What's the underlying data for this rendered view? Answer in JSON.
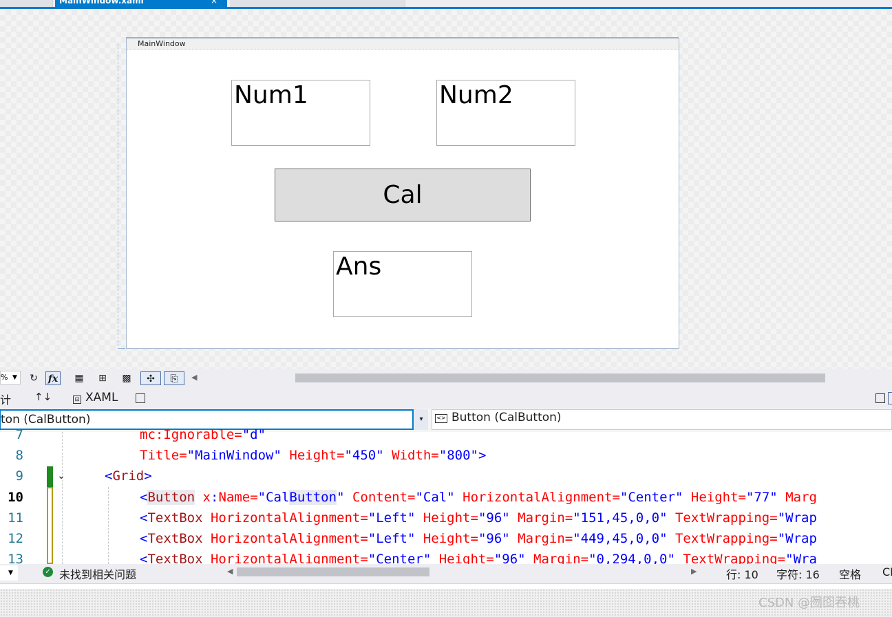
{
  "doc_tab": {
    "title": "MainWindow.xaml",
    "close_glyph": "×"
  },
  "designer": {
    "window_title": "MainWindow",
    "num1": "Num1",
    "num2": "Num2",
    "cal_button": "Cal",
    "ans": "Ans"
  },
  "toolbar": {
    "zoom_value": "%",
    "refresh_icon": "refresh-icon",
    "fx_label": "fx"
  },
  "view_tabs": {
    "design_label": "计",
    "swap_glyph": "↑↓",
    "xaml_label": "XAML"
  },
  "nav": {
    "left_value": "ton (CalButton)",
    "right_value": "Button (CalButton)",
    "dropdown_glyph": "▾"
  },
  "code": {
    "lines": [
      {
        "num": "7",
        "text": "mc:Ignorable=\"d\""
      },
      {
        "num": "8",
        "text": "Title=\"MainWindow\" Height=\"450\" Width=\"800\">"
      },
      {
        "num": "9",
        "text": "<Grid>"
      },
      {
        "num": "10",
        "text": "<Button x:Name=\"CalButton\" Content=\"Cal\" HorizontalAlignment=\"Center\" Height=\"77\" Marg"
      },
      {
        "num": "11",
        "text": "<TextBox HorizontalAlignment=\"Left\" Height=\"96\" Margin=\"151,45,0,0\" TextWrapping=\"Wrap"
      },
      {
        "num": "12",
        "text": "<TextBox HorizontalAlignment=\"Left\" Height=\"96\" Margin=\"449,45,0,0\" TextWrapping=\"Wrap"
      },
      {
        "num": "13",
        "text": "<TextBox HorizontalAlignment=\"Center\" Height=\"96\" Margin=\"0,294,0,0\" TextWrapping=\"Wra"
      }
    ]
  },
  "status": {
    "message": "未找到相关问题",
    "line": "行: 10",
    "char": "字符: 16",
    "spaces": "空格",
    "eol": "CR"
  },
  "watermark": "CSDN @囫囵吞桃"
}
